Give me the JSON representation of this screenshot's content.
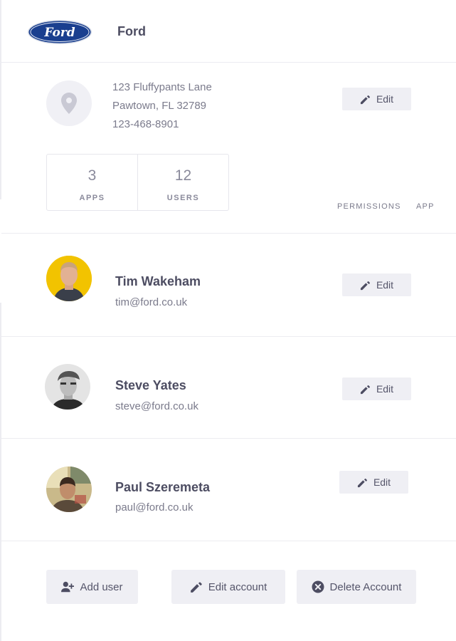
{
  "company": {
    "name": "Ford",
    "logo_text": "Ford"
  },
  "address": {
    "street": "123 Fluffypants Lane",
    "city": "Pawtown, FL 32789",
    "phone": "123-468-8901",
    "edit_label": "Edit"
  },
  "stats": [
    {
      "value": "3",
      "label": "APPS"
    },
    {
      "value": "12",
      "label": "USERS"
    }
  ],
  "tabs": [
    {
      "label": "PERMISSIONS"
    },
    {
      "label": "APP"
    }
  ],
  "users": [
    {
      "name": "Tim Wakeham",
      "email": "tim@ford.co.uk",
      "edit_label": "Edit"
    },
    {
      "name": "Steve Yates",
      "email": "steve@ford.co.uk",
      "edit_label": "Edit"
    },
    {
      "name": "Paul Szeremeta",
      "email": "paul@ford.co.uk",
      "edit_label": "Edit"
    }
  ],
  "actions": {
    "add_user": "Add user",
    "edit_account": "Edit account",
    "delete_account": "Delete Account"
  },
  "icons": {
    "location": "map-pin-icon",
    "edit": "pencil-icon",
    "add_user": "user-plus-icon",
    "delete": "x-circle-icon"
  },
  "colors": {
    "brand_blue": "#1a3f8f",
    "button_bg": "#efeff4",
    "text_dark": "#4d4d62",
    "text_muted": "#7b7b8c"
  }
}
